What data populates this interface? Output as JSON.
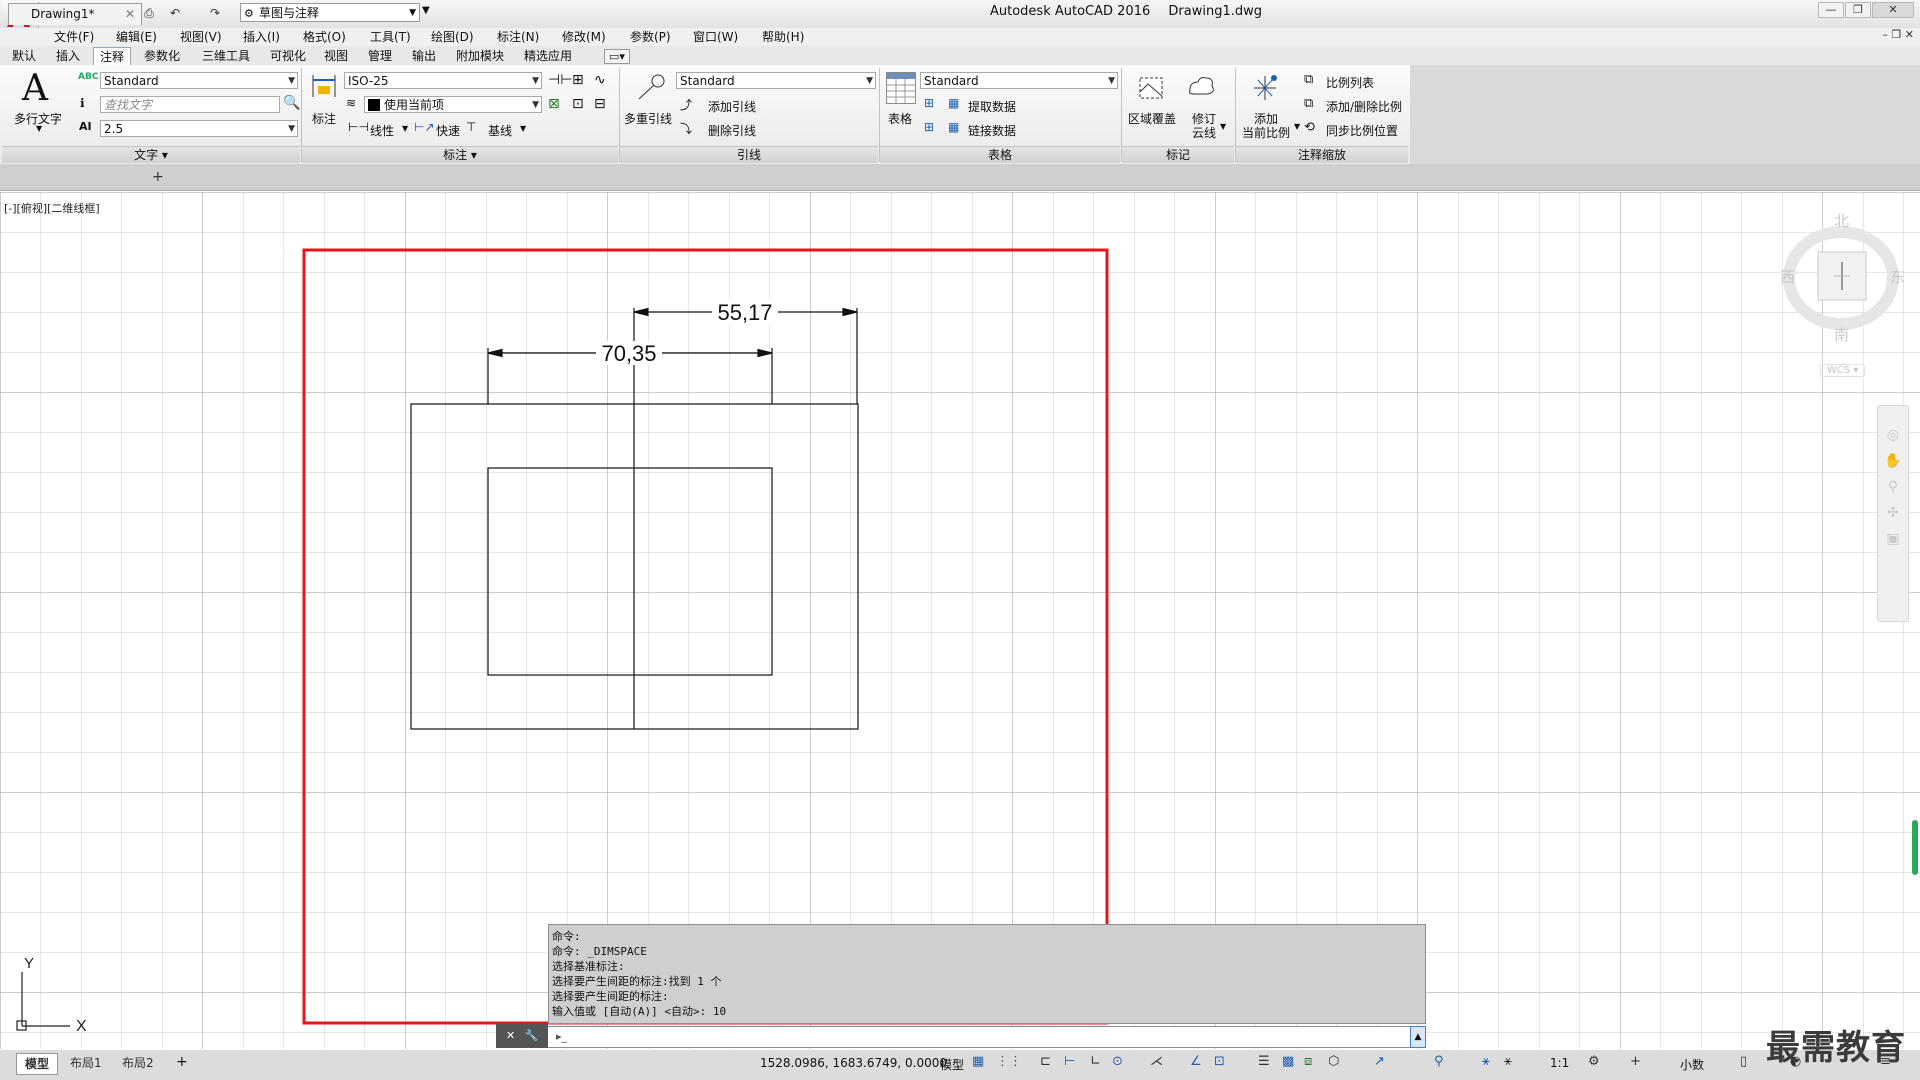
{
  "app": {
    "title": "Autodesk AutoCAD 2016",
    "file": "Drawing1.dwg",
    "workspace": "草图与注释"
  },
  "menu": [
    "文件(F)",
    "编辑(E)",
    "视图(V)",
    "插入(I)",
    "格式(O)",
    "工具(T)",
    "绘图(D)",
    "标注(N)",
    "修改(M)",
    "参数(P)",
    "窗口(W)",
    "帮助(H)"
  ],
  "ribbon_tabs": [
    "默认",
    "插入",
    "注释",
    "参数化",
    "三维工具",
    "可视化",
    "视图",
    "管理",
    "输出",
    "附加模块",
    "精选应用"
  ],
  "active_tab": "注释",
  "ribbon": {
    "text": {
      "big_button": "多行文字",
      "style": "Standard",
      "find_placeholder": "查找文字",
      "height": "2.5",
      "footer": "文字"
    },
    "dim": {
      "big_button": "标注",
      "style": "ISO-25",
      "layer": "使用当前项",
      "linear": "线性",
      "quick": "快速",
      "baseline": "基线",
      "footer": "标注"
    },
    "leader": {
      "big_button": "多重引线",
      "style": "Standard",
      "add": "添加引线",
      "remove": "删除引线",
      "footer": "引线"
    },
    "table": {
      "big_button": "表格",
      "style": "Standard",
      "extract": "提取数据",
      "link": "链接数据",
      "footer": "表格"
    },
    "markup": {
      "wipeout": "区域覆盖",
      "revcloud_line1": "修订",
      "revcloud_line2": "云线",
      "footer": "标记"
    },
    "scale": {
      "add_line1": "添加",
      "add_line2": "当前比例",
      "scale_list": "比例列表",
      "add_remove": "添加/删除比例",
      "sync": "同步比例位置",
      "footer": "注释缩放"
    }
  },
  "doc_tab": "Drawing1*",
  "viewport_label": "[-][俯视][二维线框]",
  "drawing": {
    "dim_top": "55,17",
    "dim_bottom": "70,35"
  },
  "viewcube": {
    "north": "北",
    "south": "南",
    "east": "东",
    "west": "西",
    "wcs": "WCS"
  },
  "ucs": {
    "x": "X",
    "y": "Y"
  },
  "command_history": [
    "命令:",
    "命令: _DIMSPACE",
    "选择基准标注:",
    "选择要产生间距的标注:找到 1 个",
    "选择要产生间距的标注:",
    "输入值或 [自动(A)] <自动>: 10"
  ],
  "layout_tabs": [
    "模型",
    "布局1",
    "布局2"
  ],
  "status": {
    "coords": "1528.0986, 1683.6749, 0.0000",
    "model": "模型",
    "scale": "1:1",
    "units": "小数"
  },
  "watermark": "最需教育",
  "colors": {
    "highlight_rect": "#e8141c",
    "accent_blue": "#1d5fb0",
    "autocad_red": "#c8102e"
  }
}
